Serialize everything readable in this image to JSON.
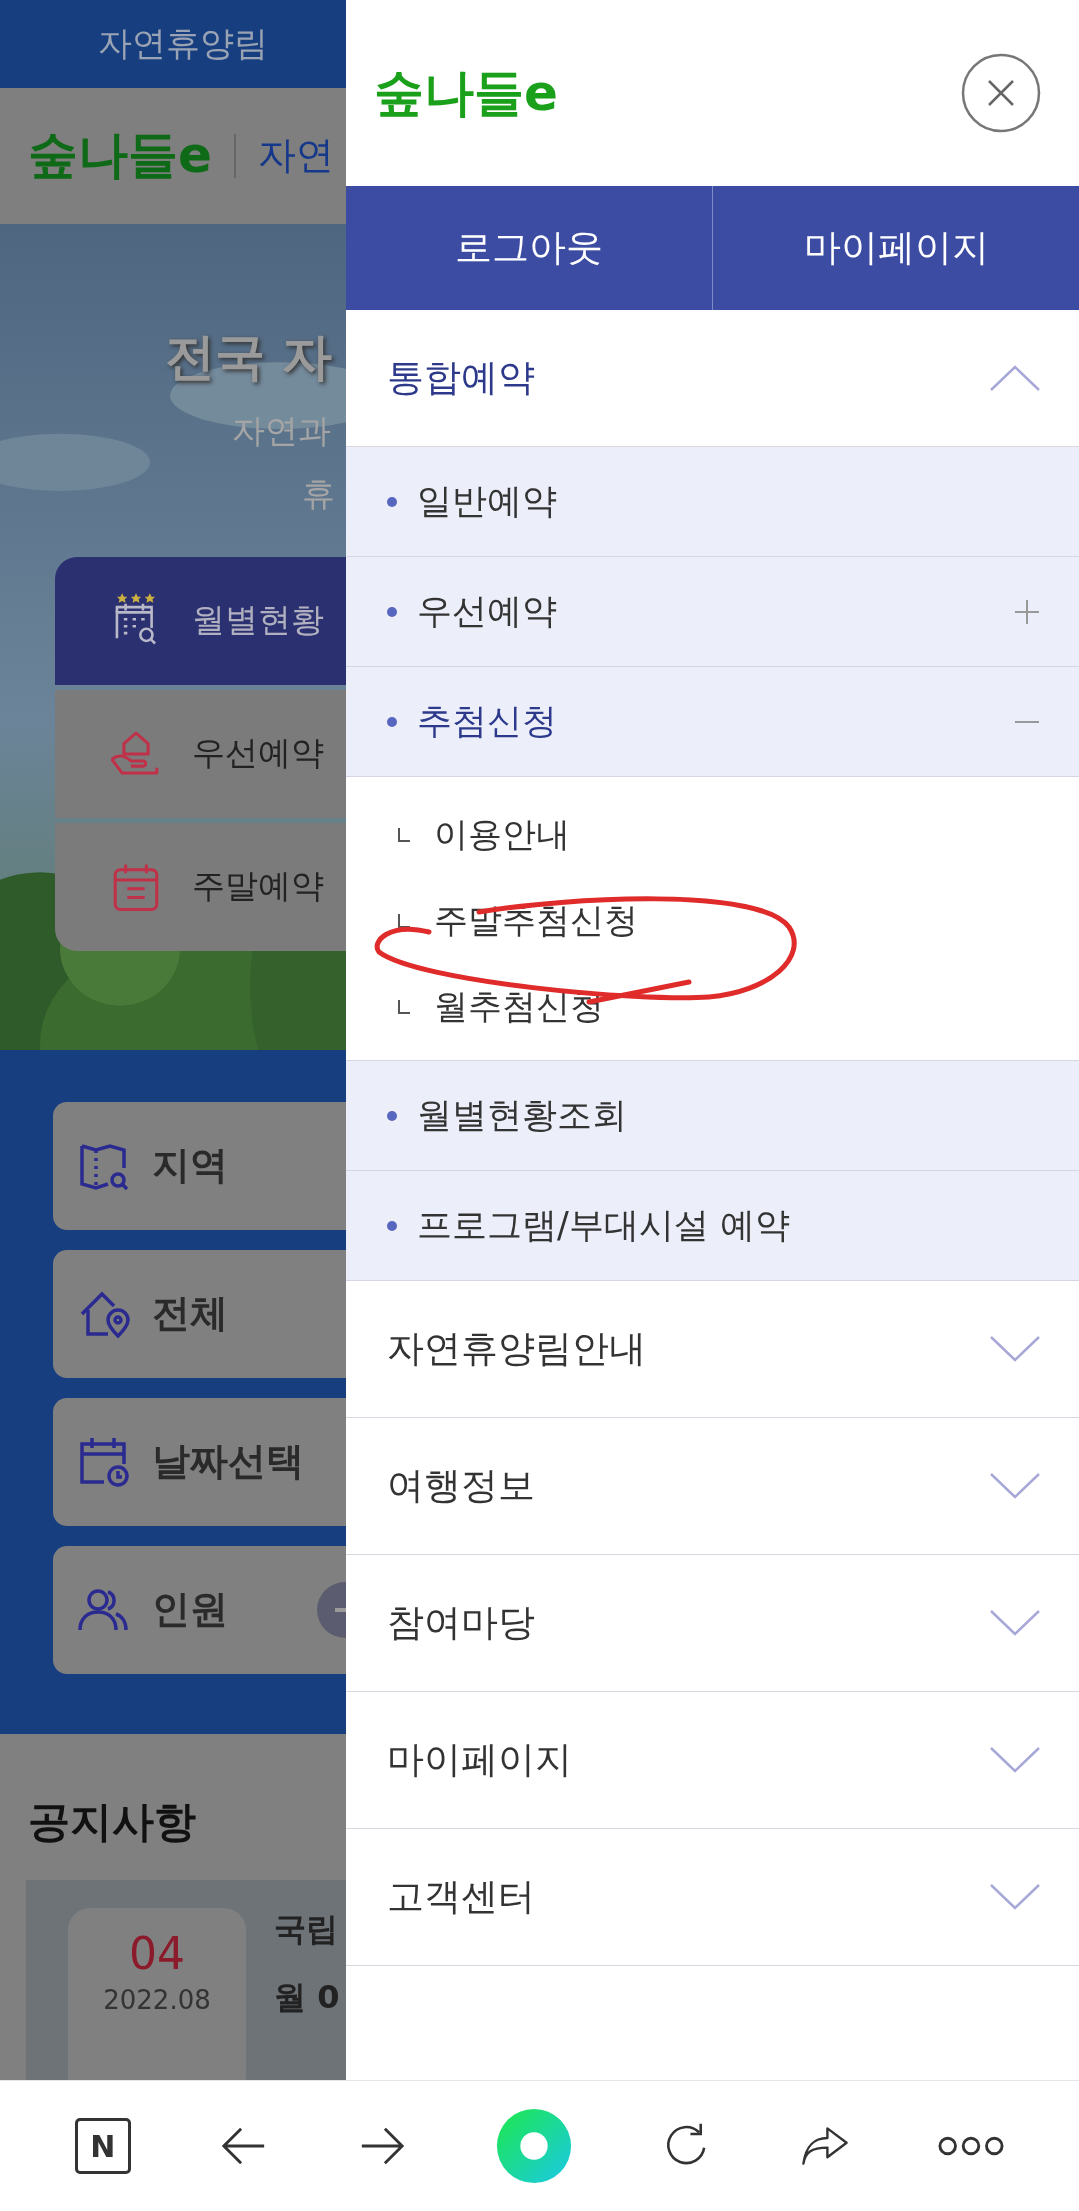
{
  "background_page": {
    "top_bar": "자연휴양림",
    "header": {
      "logo": "숲나들e",
      "title": "자연"
    },
    "hero": {
      "kind": "picture",
      "headline": "전국 자",
      "subtitle_lines": [
        "자연과",
        "휴"
      ]
    },
    "quick_menu": [
      {
        "label": "월별현황",
        "selected": true
      },
      {
        "label": "우선예약",
        "selected": false
      },
      {
        "label": "주말예약",
        "selected": false
      }
    ],
    "search_fields": [
      {
        "label": "지역"
      },
      {
        "label": "전체"
      },
      {
        "label": "날짜선택"
      },
      {
        "label": "인원"
      }
    ],
    "notices": {
      "title": "공지사항",
      "items": [
        {
          "day": "04",
          "month": "2022.08",
          "title": "국립",
          "subtitle": "월 0"
        }
      ]
    }
  },
  "drawer": {
    "logo": "숲나들e",
    "account_buttons": [
      "로그아웃",
      "마이페이지"
    ],
    "menu": [
      {
        "label": "통합예약",
        "expanded": true,
        "children": [
          {
            "label": "일반예약",
            "kind": "link",
            "expanded": false
          },
          {
            "label": "우선예약",
            "kind": "toggle",
            "expanded": false
          },
          {
            "label": "추첨신청",
            "kind": "toggle",
            "expanded": true,
            "children": [
              {
                "label": "이용안내"
              },
              {
                "label": "주말추첨신청"
              },
              {
                "label": "월추첨신청"
              }
            ]
          },
          {
            "label": "월별현황조회",
            "kind": "link",
            "expanded": false
          },
          {
            "label": "프로그램/부대시설 예약",
            "kind": "link",
            "expanded": false
          }
        ]
      },
      {
        "label": "자연휴양림안내",
        "expanded": false
      },
      {
        "label": "여행정보",
        "expanded": false
      },
      {
        "label": "참여마당",
        "expanded": false
      },
      {
        "label": "마이페이지",
        "expanded": false
      },
      {
        "label": "고객센터",
        "expanded": false
      }
    ]
  },
  "browser_toolbar": {
    "home_label": "N"
  }
}
